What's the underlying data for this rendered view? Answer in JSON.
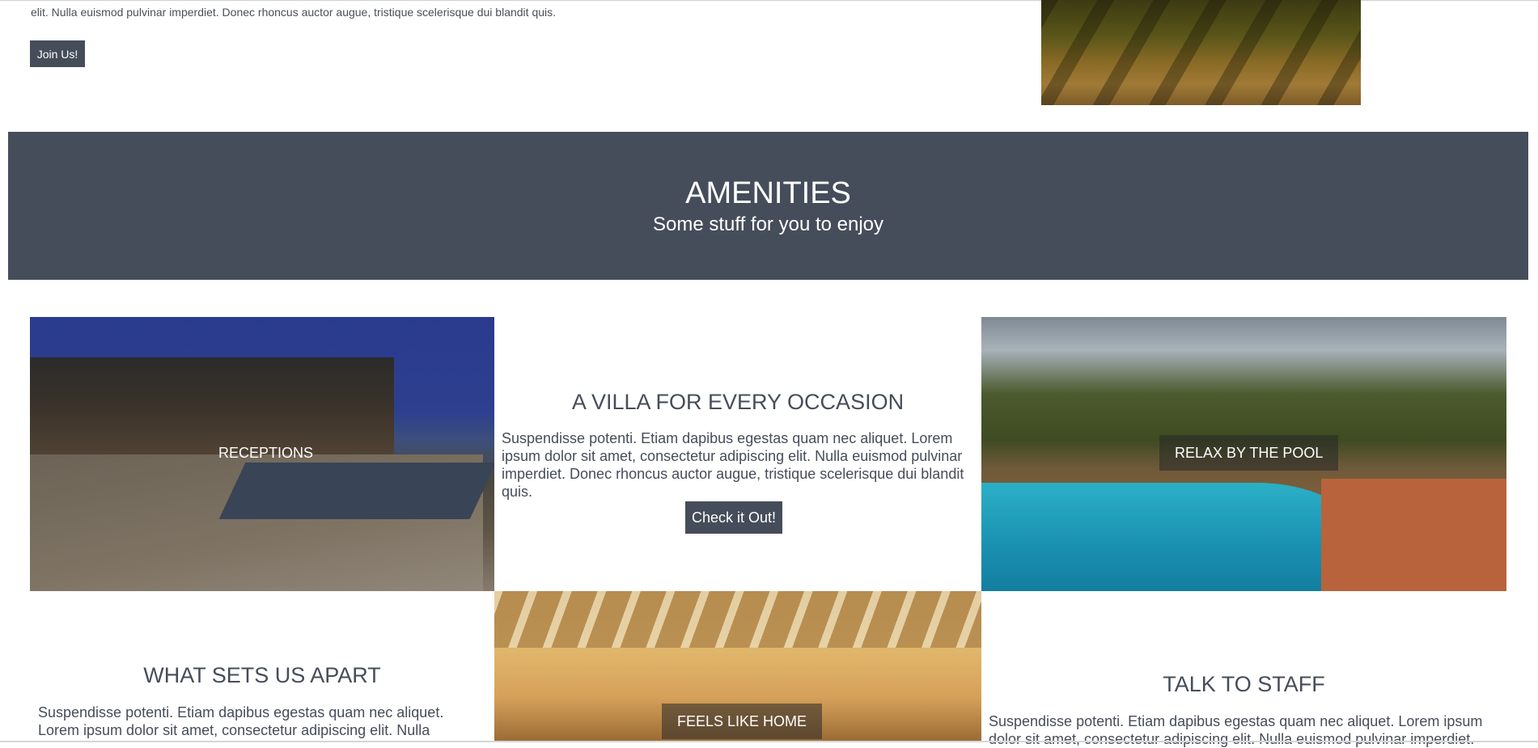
{
  "intro": {
    "text_partial_top": "…",
    "text_line": "elit. Nulla euismod pulvinar imperdiet. Donec rhoncus auctor augue, tristique scelerisque dui blandit quis.",
    "join_label": "Join Us!"
  },
  "amenities": {
    "title": "AMENITIES",
    "subtitle": "Some stuff for you to enjoy"
  },
  "grid": {
    "receptions_label": "RECEPTIONS",
    "villa": {
      "title": "A VILLA FOR EVERY OCCASION",
      "text": "Suspendisse potenti. Etiam dapibus egestas quam nec aliquet. Lorem ipsum dolor sit amet, consectetur adipiscing elit. Nulla euismod pulvinar imperdiet. Donec rhoncus auctor augue, tristique scelerisque dui blandit quis.",
      "button_label": "Check it Out!"
    },
    "pool_label": "RELAX BY THE POOL",
    "apart": {
      "title": "WHAT SETS US APART",
      "text": "Suspendisse potenti. Etiam dapibus egestas quam nec aliquet. Lorem ipsum dolor sit amet, consectetur adipiscing elit. Nulla"
    },
    "home_label": "FEELS LIKE HOME",
    "staff": {
      "title": "TALK TO STAFF",
      "text": "Suspendisse potenti. Etiam dapibus egestas quam nec aliquet. Lorem ipsum dolor sit amet, consectetur adipiscing elit. Nulla euismod pulvinar imperdiet."
    }
  },
  "colors": {
    "accent": "#464d5a",
    "text": "#464d5a",
    "background": "#ffffff"
  }
}
